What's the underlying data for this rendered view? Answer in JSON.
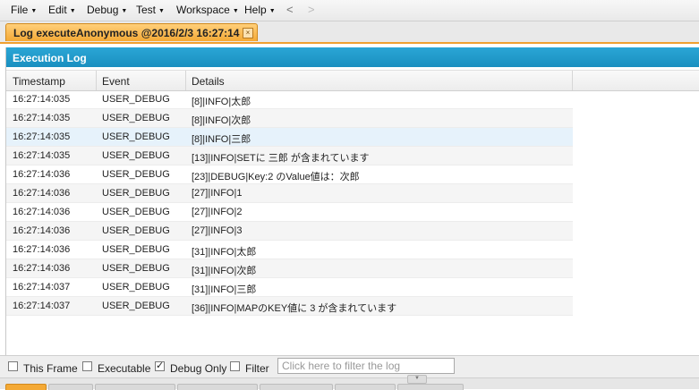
{
  "menu": {
    "items": [
      "File",
      "Edit",
      "Debug",
      "Test",
      "Workspace",
      "Help"
    ],
    "back_icon": "<",
    "forward_icon": ">"
  },
  "tab": {
    "label": "Log executeAnonymous @2016/2/3 16:27:14",
    "close_icon": "×"
  },
  "panel": {
    "title": "Execution Log"
  },
  "grid": {
    "columns": [
      "Timestamp",
      "Event",
      "Details"
    ],
    "rows": [
      {
        "timestamp": "16:27:14:035",
        "event": "USER_DEBUG",
        "details": "[8]|INFO|太郎"
      },
      {
        "timestamp": "16:27:14:035",
        "event": "USER_DEBUG",
        "details": "[8]|INFO|次郎"
      },
      {
        "timestamp": "16:27:14:035",
        "event": "USER_DEBUG",
        "details": "[8]|INFO|三郎"
      },
      {
        "timestamp": "16:27:14:035",
        "event": "USER_DEBUG",
        "details": "[13]|INFO|SETに 三郎 が含まれています"
      },
      {
        "timestamp": "16:27:14:036",
        "event": "USER_DEBUG",
        "details": "[23]|DEBUG|Key:2 のValue値は：次郎"
      },
      {
        "timestamp": "16:27:14:036",
        "event": "USER_DEBUG",
        "details": "[27]|INFO|1"
      },
      {
        "timestamp": "16:27:14:036",
        "event": "USER_DEBUG",
        "details": "[27]|INFO|2"
      },
      {
        "timestamp": "16:27:14:036",
        "event": "USER_DEBUG",
        "details": "[27]|INFO|3"
      },
      {
        "timestamp": "16:27:14:036",
        "event": "USER_DEBUG",
        "details": "[31]|INFO|太郎"
      },
      {
        "timestamp": "16:27:14:036",
        "event": "USER_DEBUG",
        "details": "[31]|INFO|次郎"
      },
      {
        "timestamp": "16:27:14:037",
        "event": "USER_DEBUG",
        "details": "[31]|INFO|三郎"
      },
      {
        "timestamp": "16:27:14:037",
        "event": "USER_DEBUG",
        "details": "[36]|INFO|MAPのKEY値に 3 が含まれています"
      }
    ]
  },
  "footer": {
    "this_frame_label": "This Frame",
    "this_frame_checked": false,
    "executable_label": "Executable",
    "executable_checked": false,
    "debug_only_label": "Debug Only",
    "debug_only_checked": true,
    "filter_label": "Filter",
    "filter_checked": false,
    "filter_placeholder": "Click here to filter the log",
    "filter_value": ""
  },
  "colors": {
    "accent_tab": "#f4a935",
    "panel_header": "#1a8fc0",
    "selected_row": "#e6f2fb"
  }
}
